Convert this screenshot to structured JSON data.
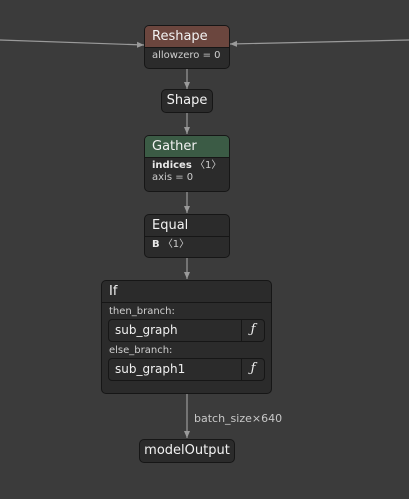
{
  "nodes": {
    "reshape": {
      "title": "Reshape",
      "attr": "allowzero = 0"
    },
    "shape": {
      "title": "Shape"
    },
    "gather": {
      "title": "Gather",
      "indices_name": "indices",
      "indices_value": "〈1〉",
      "attr": "axis = 0"
    },
    "equal": {
      "title": "Equal",
      "b_name": "B",
      "b_value": "〈1〉"
    },
    "if": {
      "title": "If",
      "then_label": "then_branch:",
      "then_value": "sub_graph",
      "else_label": "else_branch:",
      "else_value": "sub_graph1",
      "fn_glyph": "ƒ"
    },
    "output": {
      "title": "modelOutput"
    }
  },
  "edges": {
    "if_to_output_label": "batch_size×640"
  },
  "colors": {
    "background": "#3b3b3b",
    "node_fill": "#2b2b2b",
    "reshape_header": "#6b463e",
    "gather_header": "#3b5b45",
    "edge": "#9a9a9a"
  }
}
